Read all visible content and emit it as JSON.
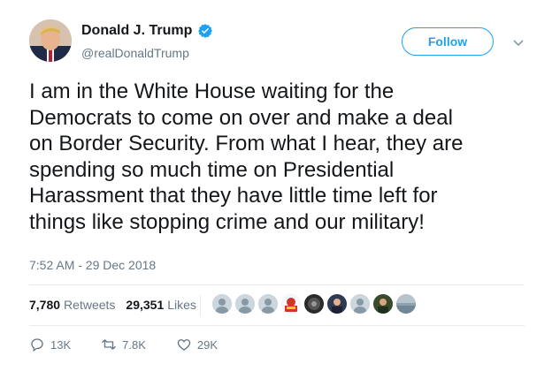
{
  "author": {
    "name": "Donald J. Trump",
    "handle": "@realDonaldTrump",
    "verified": true
  },
  "follow_label": "Follow",
  "tweet": {
    "text": "I am in the White House waiting for the\nDemocrats to come on over and make a deal\non Border Security. From what I hear, they are\nspending so much time on Presidential\nHarassment that they have little time left for\nthings like stopping crime and our military!",
    "timestamp": "7:52 AM - 29 Dec 2018"
  },
  "stats": {
    "retweets_count": "7,780",
    "retweets_label": "Retweets",
    "likes_count": "29,351",
    "likes_label": "Likes"
  },
  "actions": {
    "replies": "13K",
    "retweets": "7.8K",
    "likes": "29K"
  },
  "colors": {
    "accent": "#1da1f2",
    "secondary_text": "#657786",
    "divider": "#e6ecf0"
  }
}
